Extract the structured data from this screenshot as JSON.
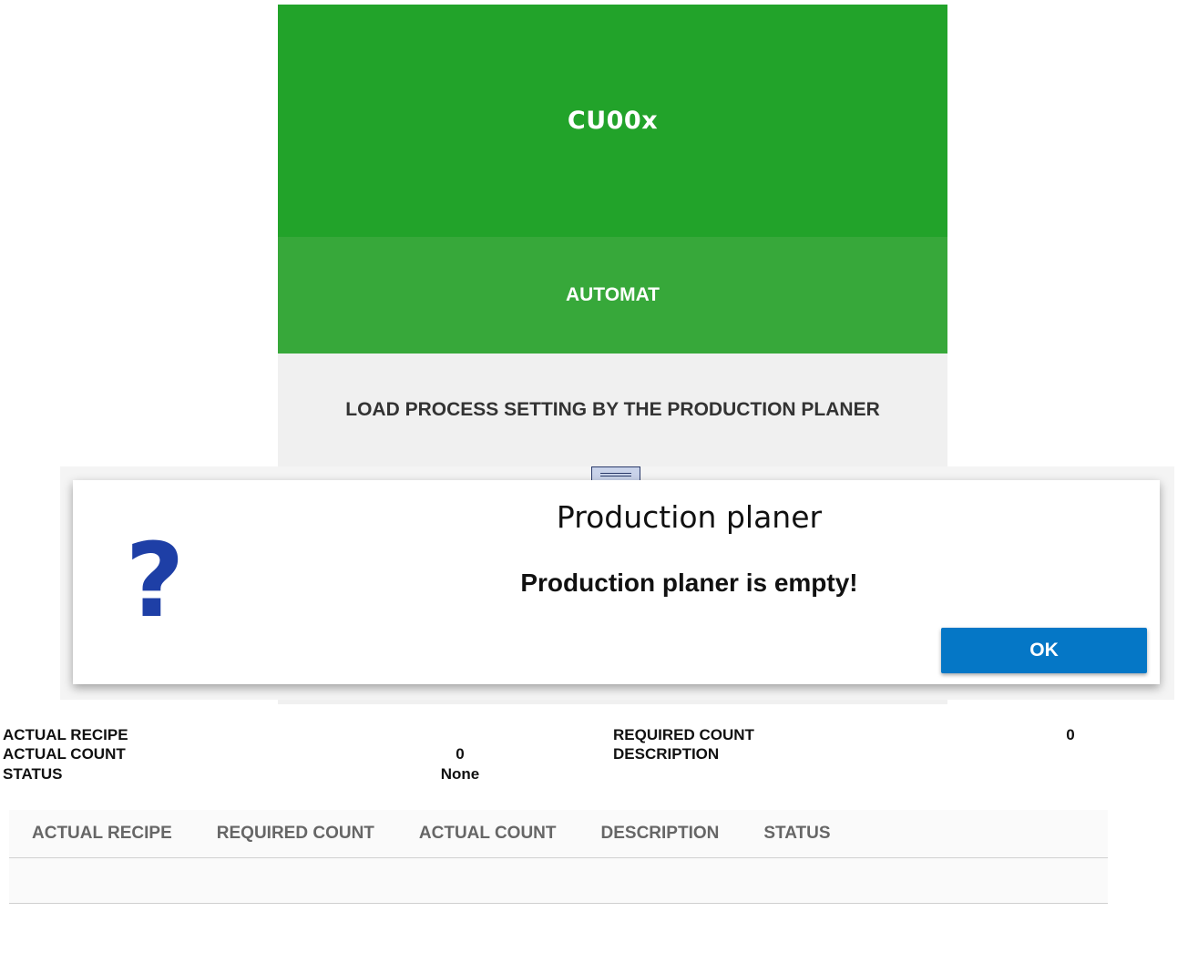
{
  "header": {
    "title": "CU00x",
    "mode": "AUTOMAT",
    "load_button": "LOAD PROCESS SETTING BY THE PRODUCTION PLANER"
  },
  "dialog": {
    "icon": "question-icon",
    "icon_glyph": "?",
    "title": "Production planer",
    "message": "Production planer is empty!",
    "ok_label": "OK"
  },
  "info": {
    "actual_recipe_label": "ACTUAL RECIPE",
    "actual_recipe_value": "",
    "actual_count_label": "ACTUAL COUNT",
    "actual_count_value": "0",
    "status_label": "STATUS",
    "status_value": "None",
    "required_count_label": "REQUIRED COUNT",
    "required_count_value": "0",
    "description_label": "DESCRIPTION",
    "description_value": ""
  },
  "table": {
    "columns": [
      "ACTUAL RECIPE",
      "REQUIRED COUNT",
      "ACTUAL COUNT",
      "DESCRIPTION",
      "STATUS"
    ],
    "rows": []
  },
  "colors": {
    "title_green": "#22a32a",
    "mode_green": "#37a83a",
    "ok_blue": "#0577c6",
    "icon_blue": "#1e3fa6"
  }
}
